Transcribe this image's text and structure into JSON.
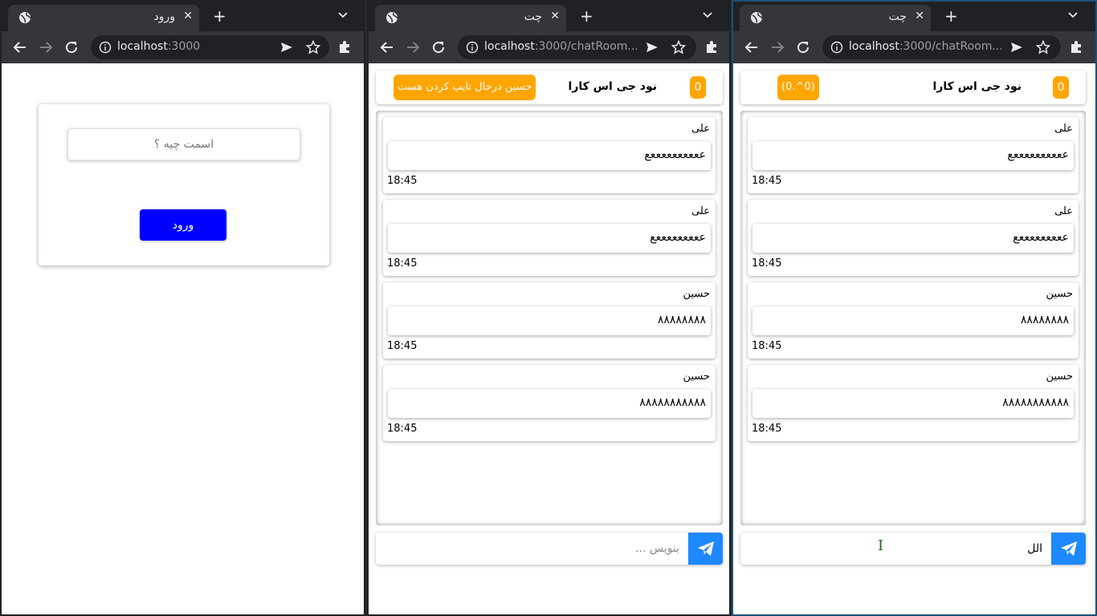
{
  "windows": [
    {
      "tab_title": "ورود",
      "url_host": "localhost",
      "url_rest": ":3000"
    },
    {
      "tab_title": "چت",
      "url_host": "localhost",
      "url_rest": ":3000/chatRoom...."
    },
    {
      "tab_title": "چت",
      "url_host": "localhost",
      "url_rest": ":3000/chatRoom...."
    }
  ],
  "login": {
    "name_placeholder": "اسمت چیه ؟",
    "login_button": "ورود"
  },
  "chat": {
    "online_count": "0",
    "room_title": "نود جی اس کارا",
    "typing_status": "حسین درحال تایپ کردن هست",
    "alt_status": "(0.^0)",
    "messages": [
      {
        "sender": "علی",
        "text": "ععععععععععع",
        "time": "18:45"
      },
      {
        "sender": "علی",
        "text": "عععععععععع",
        "time": "18:45"
      },
      {
        "sender": "حسین",
        "text": "۸۸۸۸۸۸۸۸",
        "time": "18:45"
      },
      {
        "sender": "حسین",
        "text": "۸۸۸۸۸۸۸۸۸۸۸",
        "time": "18:45"
      }
    ],
    "input_placeholder": "بنویس ...",
    "input_value_window3": "الل"
  },
  "colors": {
    "accent_orange": "#ffa500",
    "login_button_blue": "#0000ff",
    "send_button_blue": "#1e88ff"
  }
}
